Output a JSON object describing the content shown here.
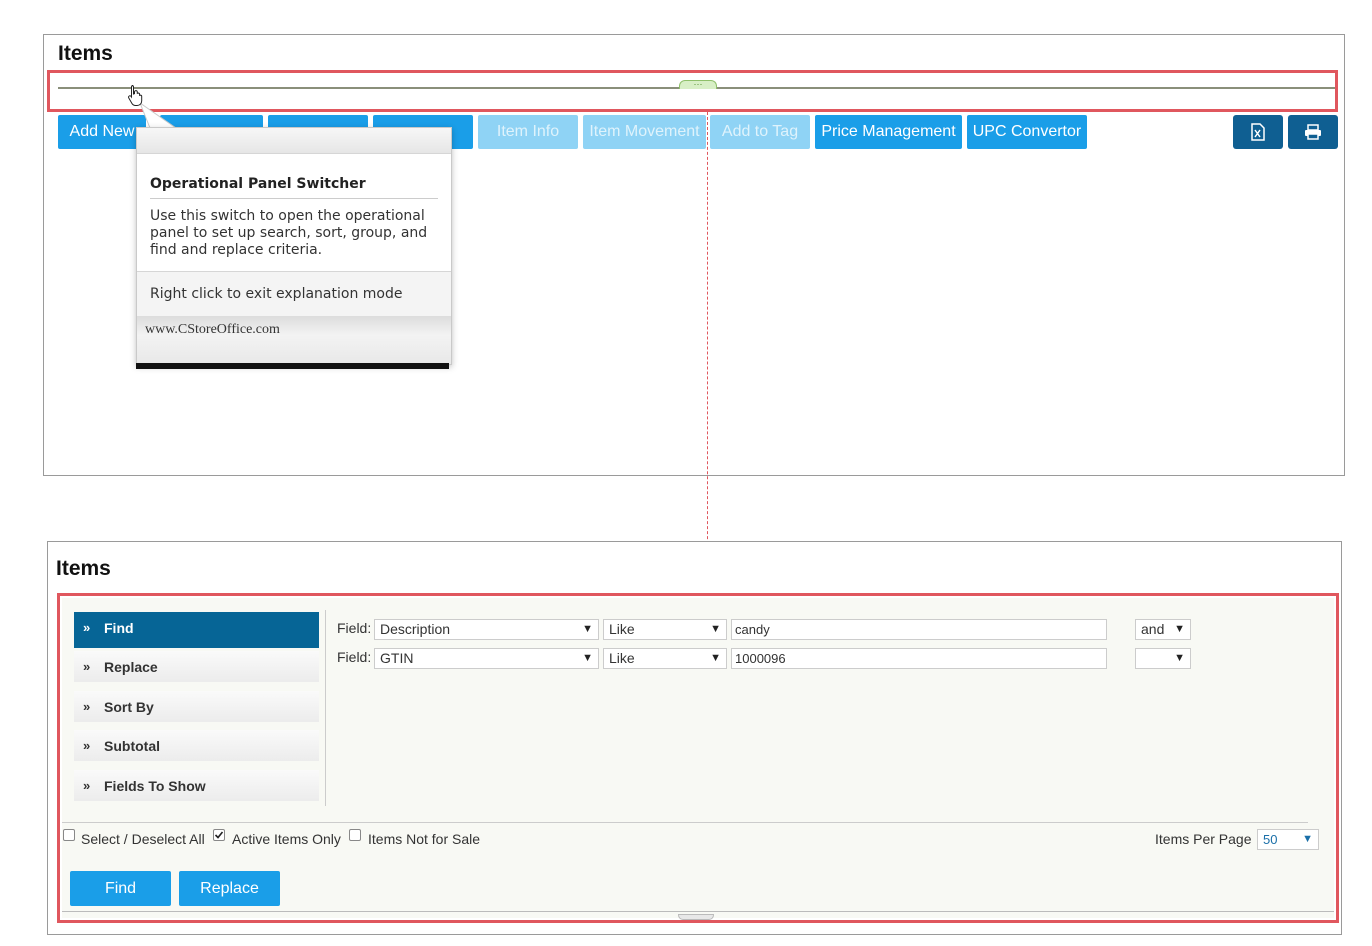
{
  "top_panel": {
    "title": "Items",
    "toolbar": {
      "add_new": "Add New",
      "item_info": "Item Info",
      "item_movement": "Item Movement",
      "add_to_tag": "Add to Tag",
      "price_management": "Price Management",
      "upc_convertor": "UPC Convertor",
      "export_excel_icon": "excel-icon",
      "print_icon": "print-icon"
    },
    "tooltip": {
      "title": "Operational Panel Switcher",
      "body": "Use this switch to open the operational panel to set up search, sort, group, and find and replace criteria.",
      "right_click": "Right click to exit explanation mode",
      "footer": "www.CStoreOffice.com"
    }
  },
  "bottom_panel": {
    "title": "Items",
    "tabs": [
      {
        "label": "Find",
        "active": true
      },
      {
        "label": "Replace",
        "active": false
      },
      {
        "label": "Sort By",
        "active": false
      },
      {
        "label": "Subtotal",
        "active": false
      },
      {
        "label": "Fields To Show",
        "active": false
      }
    ],
    "criteria": [
      {
        "label": "Field:",
        "field": "Description",
        "operator": "Like",
        "value": "candy",
        "conjunction": "and"
      },
      {
        "label": "Field:",
        "field": "GTIN",
        "operator": "Like",
        "value": "1000096",
        "conjunction": ""
      }
    ],
    "checkboxes": {
      "select_all": {
        "label": "Select / Deselect All",
        "checked": false
      },
      "active_only": {
        "label": "Active Items Only",
        "checked": true
      },
      "not_for_sale": {
        "label": "Items Not for Sale",
        "checked": false
      }
    },
    "items_per_page": {
      "label": "Items Per Page",
      "value": "50"
    },
    "buttons": {
      "find": "Find",
      "replace": "Replace"
    }
  },
  "colors": {
    "accent": "#1a9ee8",
    "active_tab": "#066596",
    "highlight": "#e0575e",
    "dark_button": "#0f5f92"
  }
}
